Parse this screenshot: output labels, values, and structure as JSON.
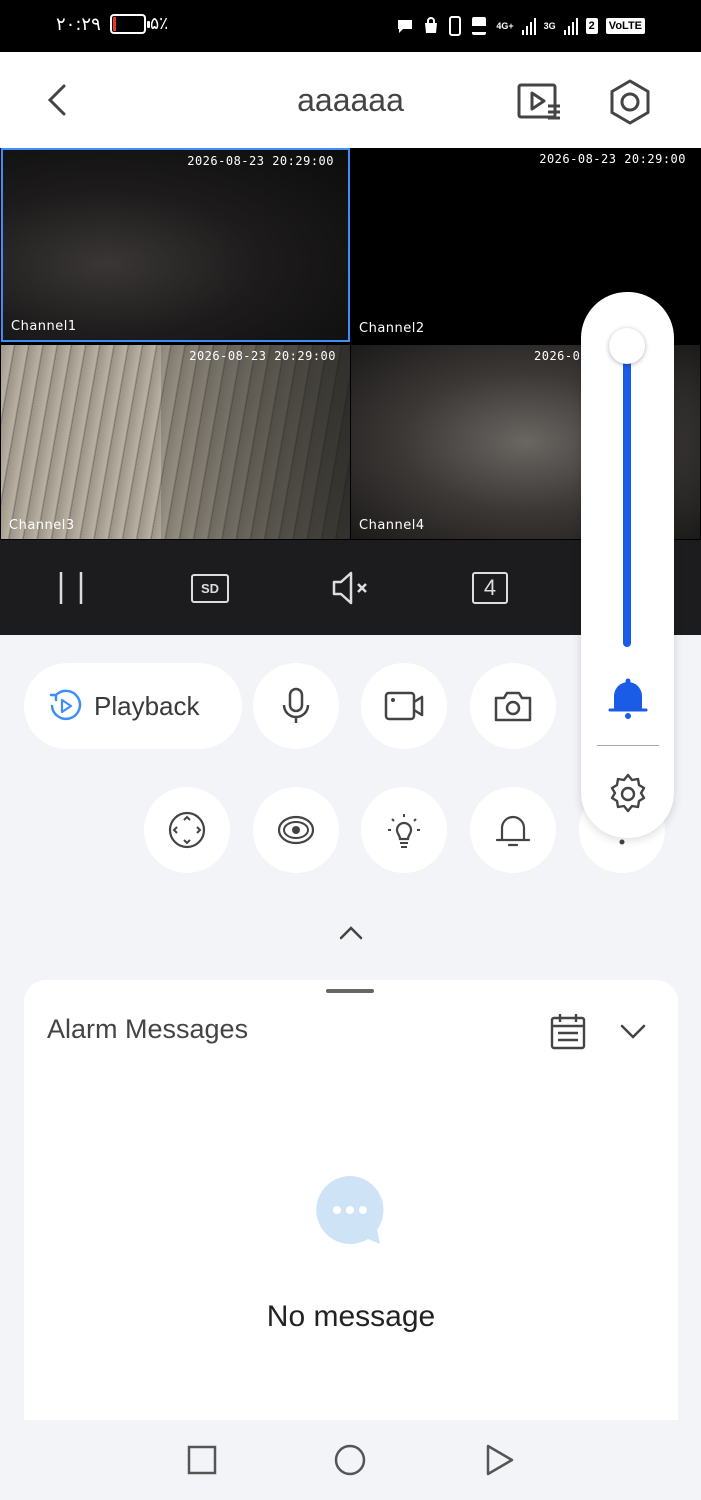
{
  "status_bar": {
    "time": "۲۰:۲۹",
    "battery_percent": "۵٪",
    "battery_level": 0.05,
    "network_1": "4G+",
    "network_2": "3G",
    "sim_number": "2",
    "volte": "VoLTE"
  },
  "header": {
    "title": "aaaaaa"
  },
  "cameras": [
    {
      "timestamp": "2026-08-23 20:29:00",
      "label": "Channel1"
    },
    {
      "timestamp": "2026-08-23 20:29:00",
      "label": "Channel2"
    },
    {
      "timestamp": "2026-08-23 20:29:00",
      "label": "Channel3"
    },
    {
      "timestamp": "2026-0",
      "label": "Channel4"
    }
  ],
  "control_bar": {
    "quality": "SD",
    "split_count": "4"
  },
  "volume_slider": {
    "level": 1.0,
    "accent_color": "#1a5ce6"
  },
  "actions": {
    "playback_label": "Playback"
  },
  "alarm": {
    "title": "Alarm Messages",
    "empty_text": "No message"
  },
  "colors": {
    "selected_border": "#3e8ef7",
    "playback_icon": "#3e8ef7",
    "empty_icon": "#cfe3f7"
  }
}
